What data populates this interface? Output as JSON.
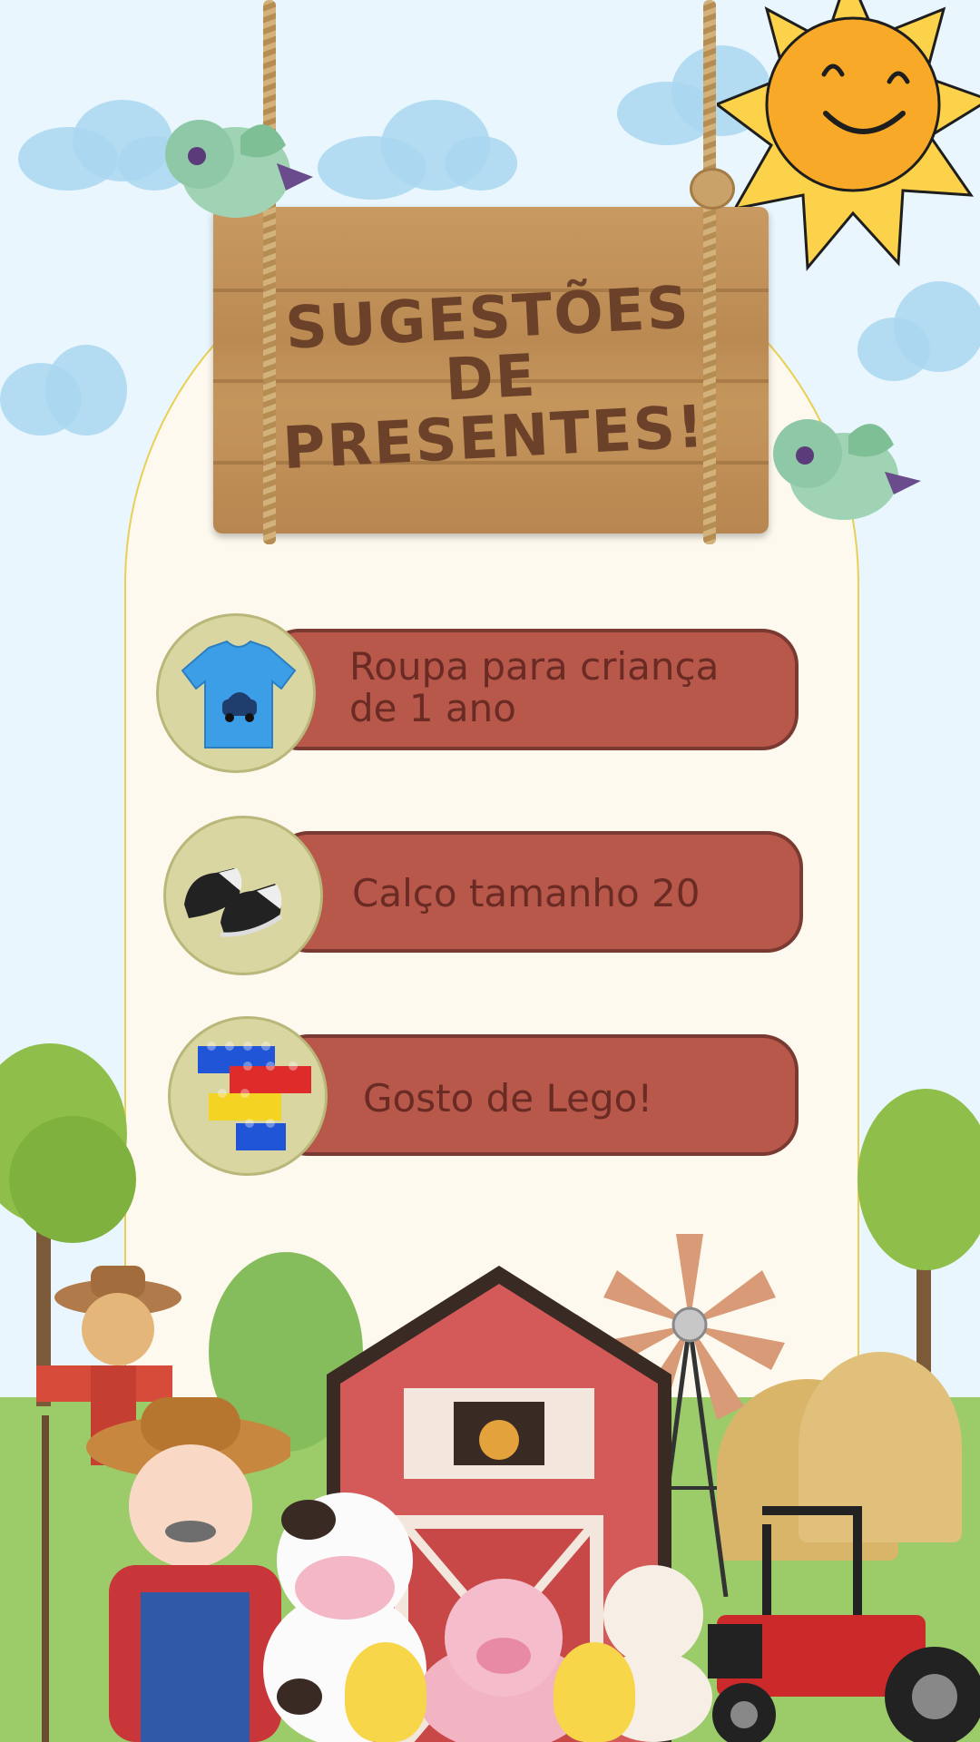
{
  "sign": {
    "title_line1": "SUGESTÕES",
    "title_line2": "DE",
    "title_line3": "PRESENTES!"
  },
  "gifts": [
    {
      "label_line1": "Roupa para criança",
      "label_line2": "de 1 ano",
      "icon": "tshirt-icon"
    },
    {
      "label": "Calço tamanho 20",
      "icon": "shoes-icon"
    },
    {
      "label": "Gosto de Lego!",
      "icon": "lego-blocks-icon"
    }
  ],
  "colors": {
    "background": "#e9f6fd",
    "card": "#fdf9ee",
    "pill": "#b8584a",
    "pill_text": "#6a2b24",
    "sign_wood": "#c89a62",
    "sign_text": "#6b4229"
  }
}
